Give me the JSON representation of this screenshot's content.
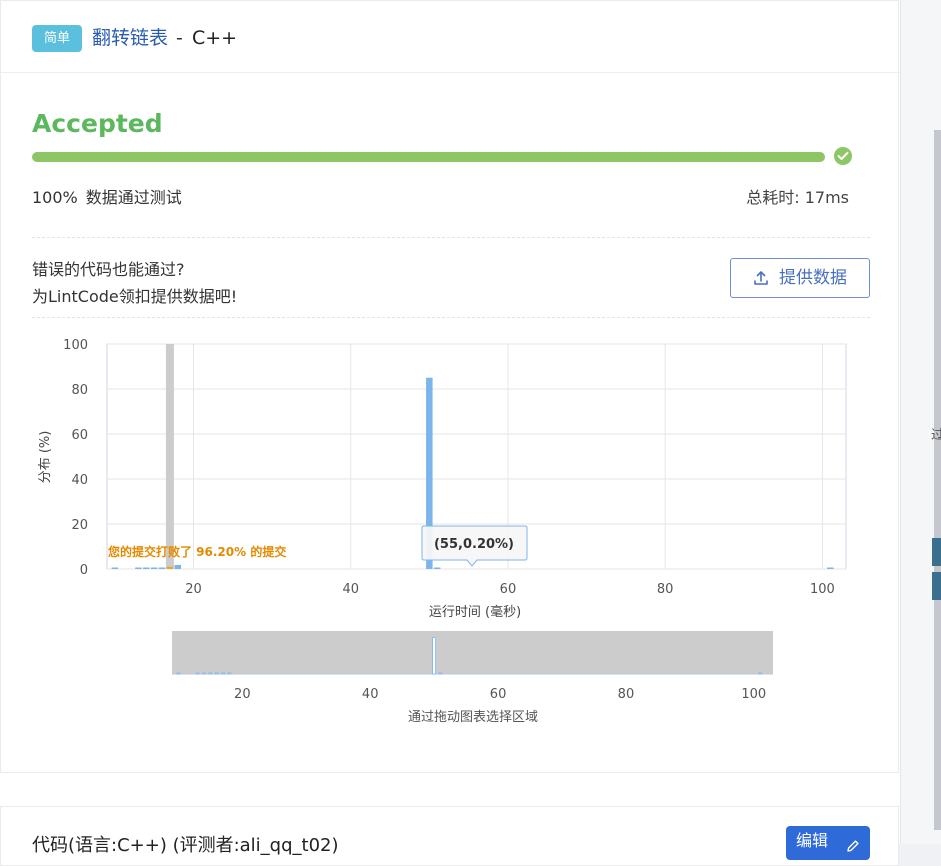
{
  "problem": {
    "difficulty": "简单",
    "title": "翻转链表",
    "separator": "-",
    "language": "C++"
  },
  "result": {
    "status": "Accepted",
    "progress_fraction": 1.0,
    "pass_percent": "100%",
    "pass_label": "数据通过测试",
    "time_label": "总耗时: 17ms"
  },
  "feedback": {
    "line1": "错误的代码也能通过?",
    "line2": "为LintCode领扣提供数据吧!",
    "button_label": "提供数据"
  },
  "chart_data": {
    "type": "bar",
    "ylabel": "分布 (%)",
    "xlabel": "运行时间 (毫秒)",
    "xlim": [
      9,
      103
    ],
    "ylim": [
      0,
      100
    ],
    "x_ticks": [
      20,
      40,
      60,
      80,
      100
    ],
    "y_ticks": [
      0,
      20,
      40,
      60,
      80,
      100
    ],
    "x": [
      10,
      13,
      14,
      15,
      16,
      17,
      18,
      50,
      51,
      101
    ],
    "values": [
      0.3,
      0.4,
      0.5,
      0.6,
      0.5,
      1.0,
      1.8,
      85.0,
      0.5,
      0.2
    ],
    "current_submission_x": 17,
    "annotation": "您的提交打败了 96.20% 的提交",
    "tooltip": "(55,0.20%)",
    "navigator_ticks": [
      20,
      40,
      60,
      80,
      100
    ],
    "navigator_label": "通过拖动图表选择区域",
    "colors": {
      "bar": "#7cb5ec",
      "current": "#f0a32f",
      "marker": "#cccccc",
      "annotation": "#e58a00"
    }
  },
  "code_section": {
    "title": "代码(语言:C++) (评测者:ali_qq_t02)",
    "edit_label": "编辑"
  }
}
